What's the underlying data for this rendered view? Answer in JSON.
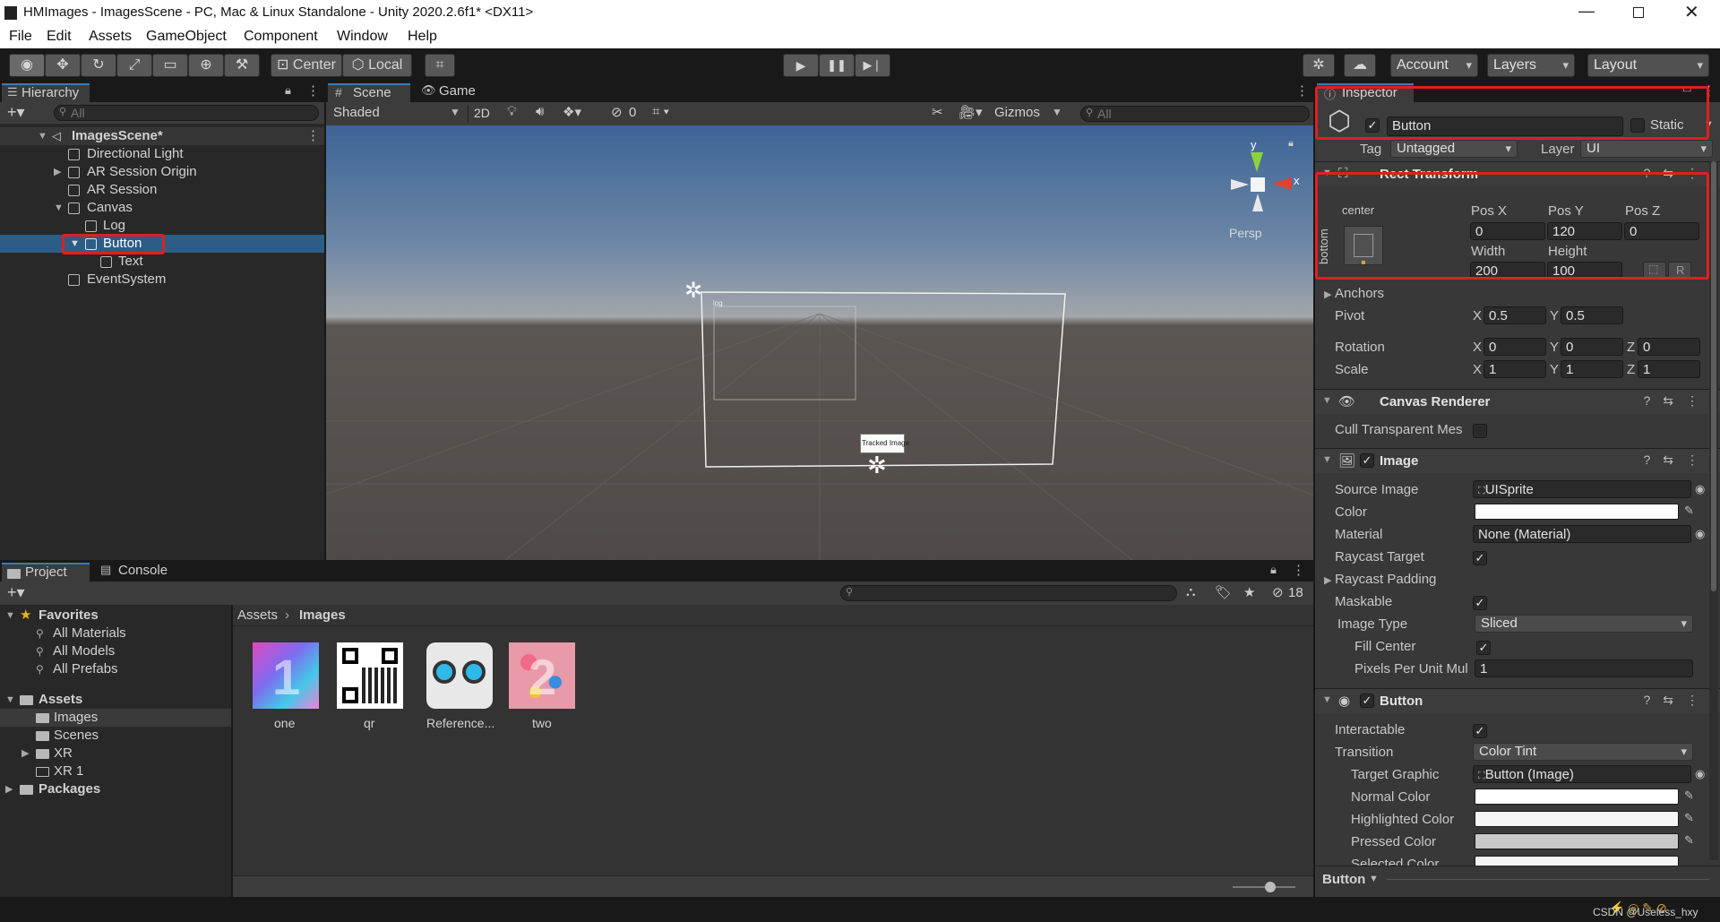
{
  "window": {
    "title": "HMImages - ImagesScene - PC, Mac & Linux Standalone - Unity 2020.2.6f1* <DX11>",
    "controls": [
      "minimize-icon",
      "restore-icon",
      "close-icon"
    ]
  },
  "menu": [
    "File",
    "Edit",
    "Assets",
    "GameObject",
    "Component",
    "Window",
    "Help"
  ],
  "toolbar": {
    "center_label": "Center",
    "local_label": "Local",
    "account_label": "Account",
    "layers_label": "Layers",
    "layout_label": "Layout"
  },
  "hierarchy": {
    "tab": "Hierarchy",
    "search_placeholder": "All",
    "scene": "ImagesScene*",
    "items": [
      {
        "label": "Directional Light"
      },
      {
        "label": "AR Session Origin"
      },
      {
        "label": "AR Session"
      },
      {
        "label": "Canvas"
      },
      {
        "label": "Log"
      },
      {
        "label": "Button"
      },
      {
        "label": "Text"
      },
      {
        "label": "EventSystem"
      }
    ]
  },
  "scene_view": {
    "tab_scene": "Scene",
    "tab_game": "Game",
    "shading": "Shaded",
    "mode_2d": "2D",
    "hidden_count": "0",
    "gizmos": "Gizmos",
    "search_placeholder": "All",
    "persp": "Persp",
    "axis_y": "y",
    "axis_x": "x",
    "log_label": "log",
    "tracked_label": "Tracked Image"
  },
  "project": {
    "tab_project": "Project",
    "tab_console": "Console",
    "visible_count": "18",
    "favorites": "Favorites",
    "fav_items": [
      "All Materials",
      "All Models",
      "All Prefabs"
    ],
    "assets": "Assets",
    "asset_folders": [
      "Images",
      "Scenes",
      "XR",
      "XR 1"
    ],
    "packages": "Packages",
    "breadcrumb": [
      "Assets",
      "Images"
    ],
    "thumbnails": [
      "one",
      "qr",
      "Reference...",
      "two"
    ]
  },
  "inspector": {
    "tab": "Inspector",
    "object_name": "Button",
    "static_label": "Static",
    "tag_label": "Tag",
    "tag_value": "Untagged",
    "layer_label": "Layer",
    "layer_value": "UI",
    "rect_transform": {
      "title": "Rect Transform",
      "anchor_h": "center",
      "anchor_v": "bottom",
      "posx_label": "Pos X",
      "posx": "0",
      "posy_label": "Pos Y",
      "posy": "120",
      "posz_label": "Pos Z",
      "posz": "0",
      "width_label": "Width",
      "width": "200",
      "height_label": "Height",
      "height": "100",
      "r_btn": "R",
      "anchors_label": "Anchors",
      "pivot_label": "Pivot",
      "pivot_x": "0.5",
      "pivot_y": "0.5",
      "rotation_label": "Rotation",
      "rot_x": "0",
      "rot_y": "0",
      "rot_z": "0",
      "scale_label": "Scale",
      "scale_x": "1",
      "scale_y": "1",
      "scale_z": "1",
      "x": "X",
      "y": "Y",
      "z": "Z"
    },
    "canvas_renderer": {
      "title": "Canvas Renderer",
      "cull_label": "Cull Transparent Mes"
    },
    "image": {
      "title": "Image",
      "source_label": "Source Image",
      "source_value": "UISprite",
      "color_label": "Color",
      "material_label": "Material",
      "material_value": "None (Material)",
      "raycast_label": "Raycast Target",
      "raycast_padding_label": "Raycast Padding",
      "maskable_label": "Maskable",
      "image_type_label": "Image Type",
      "image_type_value": "Sliced",
      "fill_center_label": "Fill Center",
      "ppu_label": "Pixels Per Unit Mul",
      "ppu_value": "1"
    },
    "button": {
      "title": "Button",
      "interactable_label": "Interactable",
      "transition_label": "Transition",
      "transition_value": "Color Tint",
      "target_graphic_label": "Target Graphic",
      "target_graphic_value": "Button (Image)",
      "normal_label": "Normal Color",
      "highlighted_label": "Highlighted Color",
      "pressed_label": "Pressed Color",
      "selected_label": "Selected Color"
    },
    "footer_label": "Button"
  },
  "statusbar": {
    "watermark": "CSDN @Useless_hxy"
  },
  "colors": {
    "selection": "#2c5d87",
    "highlight_box": "#e01f1f",
    "normal_color": "#ffffff",
    "highlighted_color": "#f5f5f5",
    "pressed_color": "#c8c8c8"
  }
}
